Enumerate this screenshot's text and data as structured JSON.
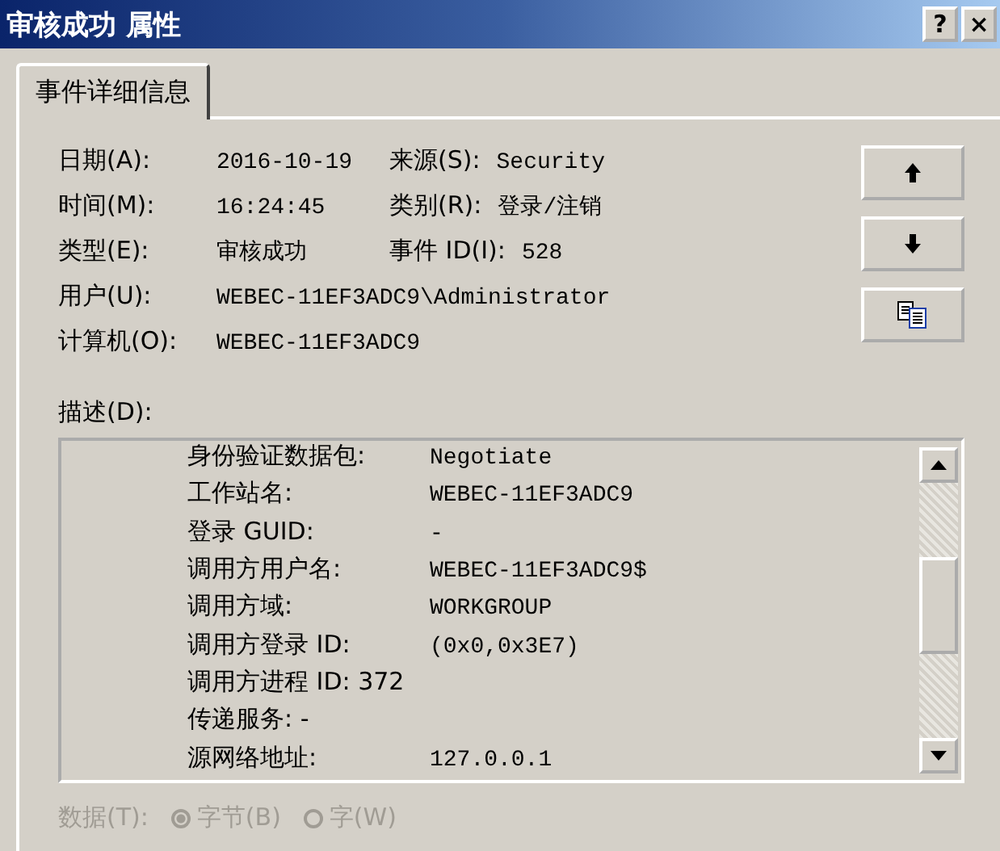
{
  "window": {
    "title": "审核成功 属性",
    "help_button": "?",
    "close_button": "×"
  },
  "tabs": [
    {
      "label": "事件详细信息",
      "selected": true
    }
  ],
  "fields": [
    {
      "label": "日期(A):",
      "value": "2016-10-19",
      "label2": "来源(S):",
      "value2": "Security"
    },
    {
      "label": "时间(M):",
      "value": "16:24:45",
      "label2": "类别(R):",
      "value2": "登录/注销"
    },
    {
      "label": "类型(E):",
      "value": "审核成功",
      "label2": "事件 ID(I):",
      "value2": "528"
    },
    {
      "label": "用户(U):",
      "value": "WEBEC-11EF3ADC9\\Administrator"
    },
    {
      "label": "计算机(O):",
      "value": "WEBEC-11EF3ADC9"
    }
  ],
  "side_buttons": [
    {
      "kind": "up"
    },
    {
      "kind": "down"
    },
    {
      "kind": "copy"
    }
  ],
  "description": {
    "label": "描述(D):",
    "rows": [
      {
        "kind": "pair",
        "label": "身份验证数据包:",
        "value": "Negotiate"
      },
      {
        "kind": "pair",
        "label": "工作站名:",
        "value": "WEBEC-11EF3ADC9"
      },
      {
        "kind": "pair",
        "label": "登录 GUID:",
        "value": "-"
      },
      {
        "kind": "pair",
        "label": "调用方用户名:",
        "value": "WEBEC-11EF3ADC9$"
      },
      {
        "kind": "pair",
        "label": "调用方域:",
        "value": "WORKGROUP"
      },
      {
        "kind": "pair",
        "label": "调用方登录 ID:",
        "value": "(0x0,0x3E7)"
      },
      {
        "kind": "line",
        "text": "调用方进程 ID: 372"
      },
      {
        "kind": "line",
        "text": "传递服务: -"
      },
      {
        "kind": "pair",
        "label": "源网络地址:",
        "value": "127.0.0.1"
      }
    ]
  },
  "data": {
    "label": "数据(T):",
    "disabled": true,
    "options": [
      {
        "label": "字节(B)",
        "selected": true
      },
      {
        "label": "字(W)",
        "selected": false
      }
    ]
  }
}
